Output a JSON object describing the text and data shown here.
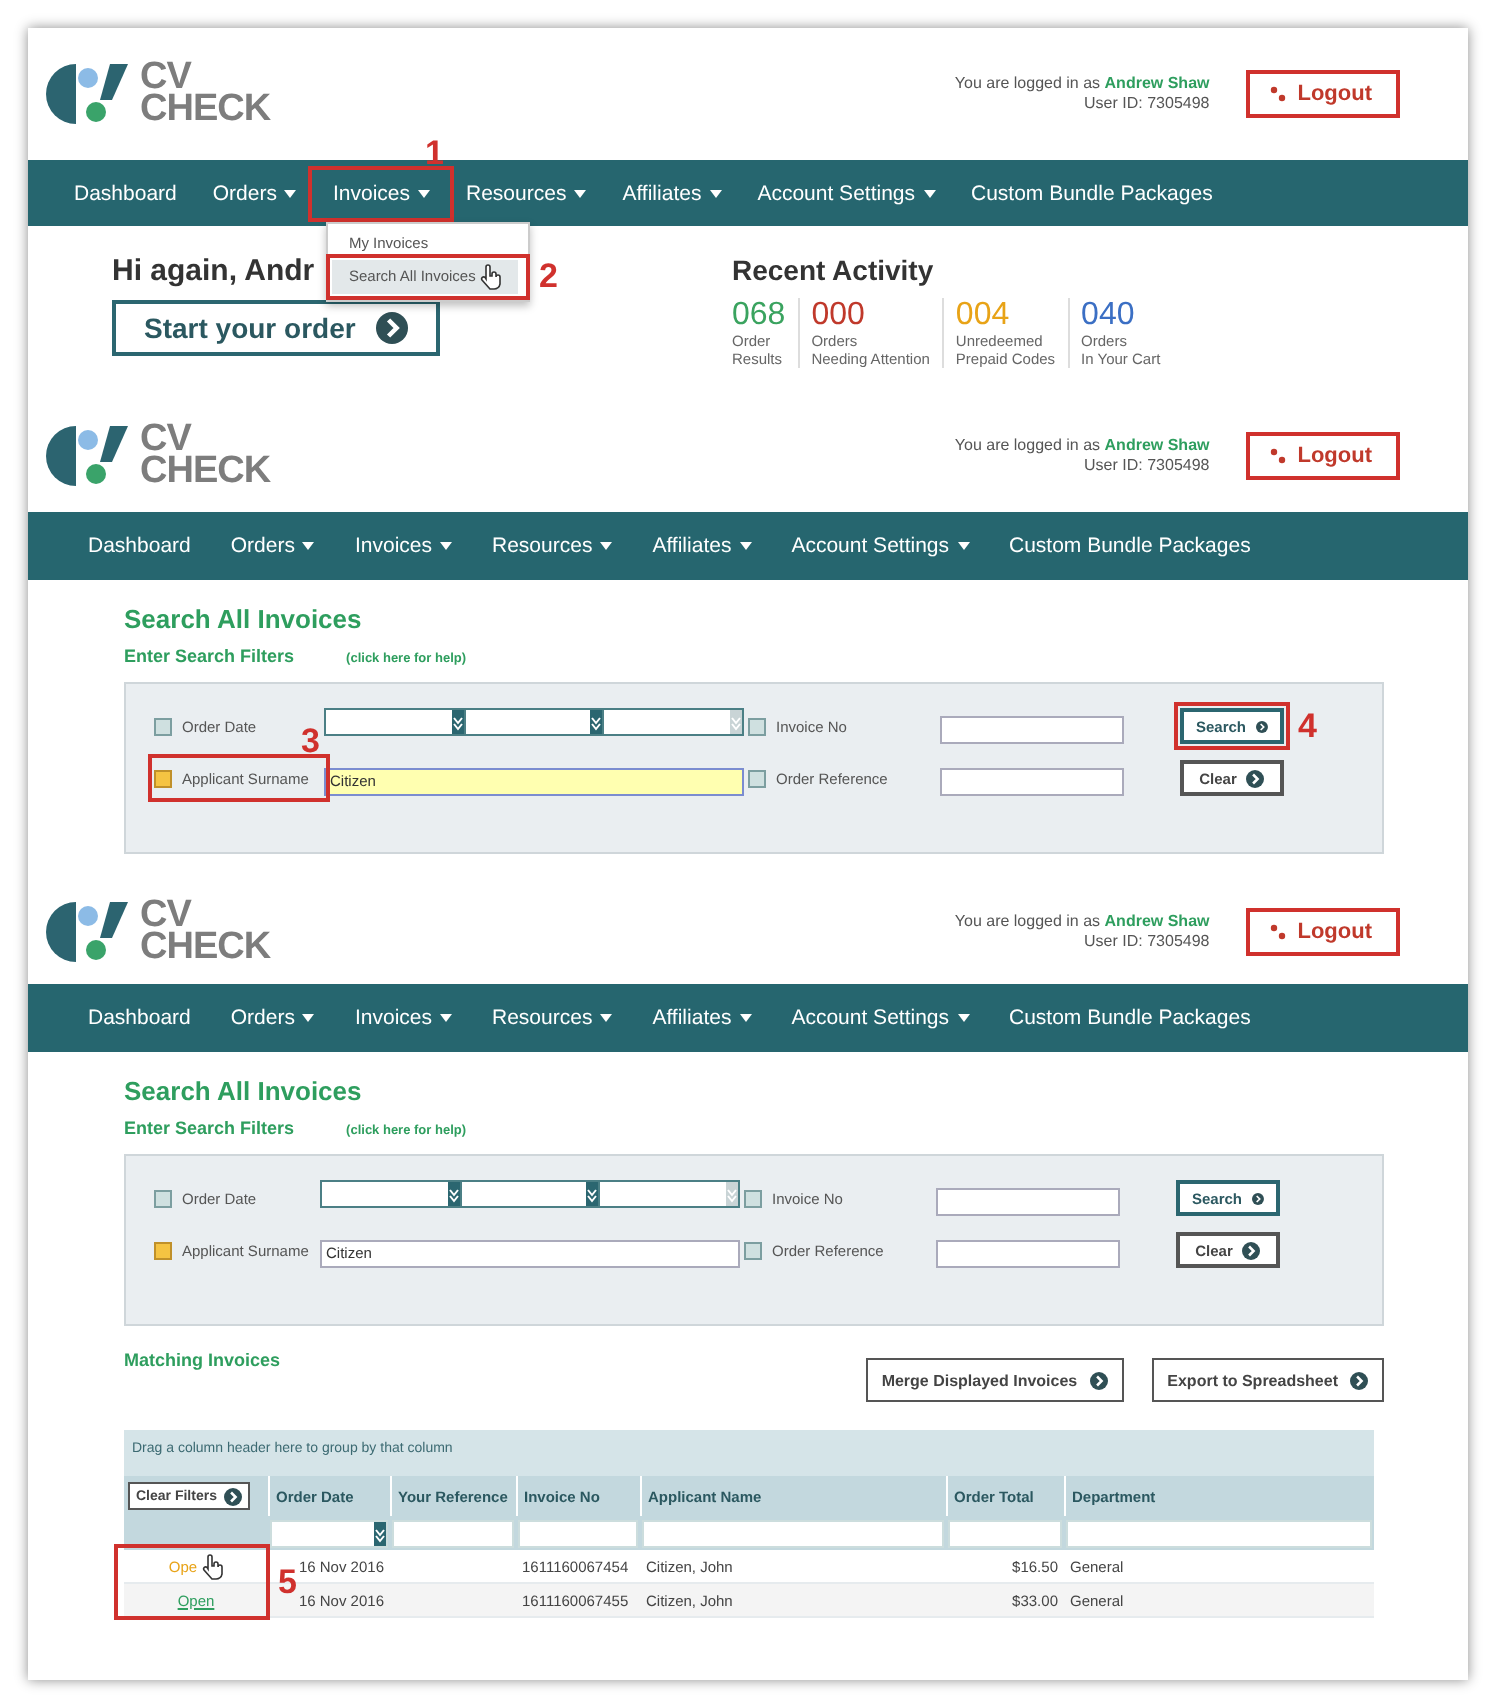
{
  "panels": [
    {
      "kind": "dashboard",
      "header": {
        "logo_top": "CV",
        "logo_bottom": "CHECK",
        "login_prefix": "You are logged in as",
        "user_name": "Andrew Shaw",
        "user_id": "User ID: 7305498",
        "logout": "Logout"
      },
      "nav": [
        {
          "label": "Dashboard",
          "dropdown": false
        },
        {
          "label": "Orders",
          "dropdown": true
        },
        {
          "label": "Invoices",
          "dropdown": true,
          "callout": {
            "number": "1"
          },
          "menu": [
            {
              "label": "My Invoices",
              "selected": false
            },
            {
              "label": "Search All Invoices",
              "selected": true,
              "callout": {
                "number": "2"
              }
            }
          ]
        },
        {
          "label": "Resources",
          "dropdown": true
        },
        {
          "label": "Affiliates",
          "dropdown": true
        },
        {
          "label": "Account Settings",
          "dropdown": true
        },
        {
          "label": "Custom Bundle Packages",
          "dropdown": false
        }
      ],
      "greeting": "Hi again, Andr",
      "start_button": "Start your order",
      "activity_title": "Recent Activity",
      "stats": [
        {
          "value": "068",
          "label": "Order\nResults",
          "color": "#3aa35f"
        },
        {
          "value": "000",
          "label": "Orders\nNeeding Attention",
          "color": "#c0392b"
        },
        {
          "value": "004",
          "label": "Unredeemed\nPrepaid Codes",
          "color": "#e8a317"
        },
        {
          "value": "040",
          "label": "Orders\nIn Your Cart",
          "color": "#3b6fc4"
        }
      ]
    },
    {
      "kind": "search",
      "header": {
        "logo_top": "CV",
        "logo_bottom": "CHECK",
        "login_prefix": "You are logged in as",
        "user_name": "Andrew Shaw",
        "user_id": "User ID: 7305498",
        "logout": "Logout"
      },
      "nav": [
        {
          "label": "Dashboard",
          "dropdown": false
        },
        {
          "label": "Orders",
          "dropdown": true
        },
        {
          "label": "Invoices",
          "dropdown": true
        },
        {
          "label": "Resources",
          "dropdown": true
        },
        {
          "label": "Affiliates",
          "dropdown": true
        },
        {
          "label": "Account Settings",
          "dropdown": true
        },
        {
          "label": "Custom Bundle Packages",
          "dropdown": false
        }
      ],
      "title": "Search All Invoices",
      "filters_title": "Enter Search Filters",
      "help_link": "(click here for help)",
      "filters": [
        {
          "kind": "date_range",
          "label": "Order Date",
          "checked": false
        },
        {
          "kind": "text",
          "label": "Invoice No",
          "checked": false
        },
        {
          "kind": "text",
          "label": "Applicant Surname",
          "checked": true,
          "value": "Citizen",
          "highlighted": true,
          "callout": {
            "number": "3"
          }
        },
        {
          "kind": "text",
          "label": "Order Reference",
          "checked": false
        }
      ],
      "buttons": [
        {
          "label": "Search",
          "callout": {
            "number": "4"
          }
        },
        {
          "label": "Clear"
        }
      ]
    },
    {
      "kind": "results",
      "header": {
        "logo_top": "CV",
        "logo_bottom": "CHECK",
        "login_prefix": "You are logged in as",
        "user_name": "Andrew Shaw",
        "user_id": "User ID: 7305498",
        "logout": "Logout"
      },
      "nav": [
        {
          "label": "Dashboard",
          "dropdown": false
        },
        {
          "label": "Orders",
          "dropdown": true
        },
        {
          "label": "Invoices",
          "dropdown": true
        },
        {
          "label": "Resources",
          "dropdown": true
        },
        {
          "label": "Affiliates",
          "dropdown": true
        },
        {
          "label": "Account Settings",
          "dropdown": true
        },
        {
          "label": "Custom Bundle Packages",
          "dropdown": false
        }
      ],
      "title": "Search All Invoices",
      "filters_title": "Enter Search Filters",
      "help_link": "(click here for help)",
      "filters": [
        {
          "kind": "date_range",
          "label": "Order Date",
          "checked": false
        },
        {
          "kind": "text",
          "label": "Invoice No",
          "checked": false
        },
        {
          "kind": "text",
          "label": "Applicant Surname",
          "checked": true,
          "value": "Citizen",
          "highlighted": false
        },
        {
          "kind": "text",
          "label": "Order Reference",
          "checked": false
        }
      ],
      "buttons": [
        {
          "label": "Search"
        },
        {
          "label": "Clear"
        }
      ],
      "matching_title": "Matching Invoices",
      "actions": [
        "Merge Displayed Invoices",
        "Export to Spreadsheet"
      ],
      "grid": {
        "group_hint": "Drag a column header here to group by that column",
        "clear_filters": "Clear Filters",
        "columns": [
          "Order Date",
          "Your Reference",
          "Invoice No",
          "Applicant Name",
          "Order Total",
          "Department"
        ],
        "callout": {
          "number": "5"
        },
        "rows": [
          {
            "link": "Ope",
            "hovered": true,
            "cells": [
              "16 Nov 2016",
              "",
              "1611160067454",
              "Citizen, John",
              "$16.50",
              "General"
            ]
          },
          {
            "link": "Open",
            "hovered": false,
            "cells": [
              "16 Nov 2016",
              "",
              "1611160067455",
              "Citizen, John",
              "$33.00",
              "General"
            ]
          }
        ]
      }
    }
  ]
}
